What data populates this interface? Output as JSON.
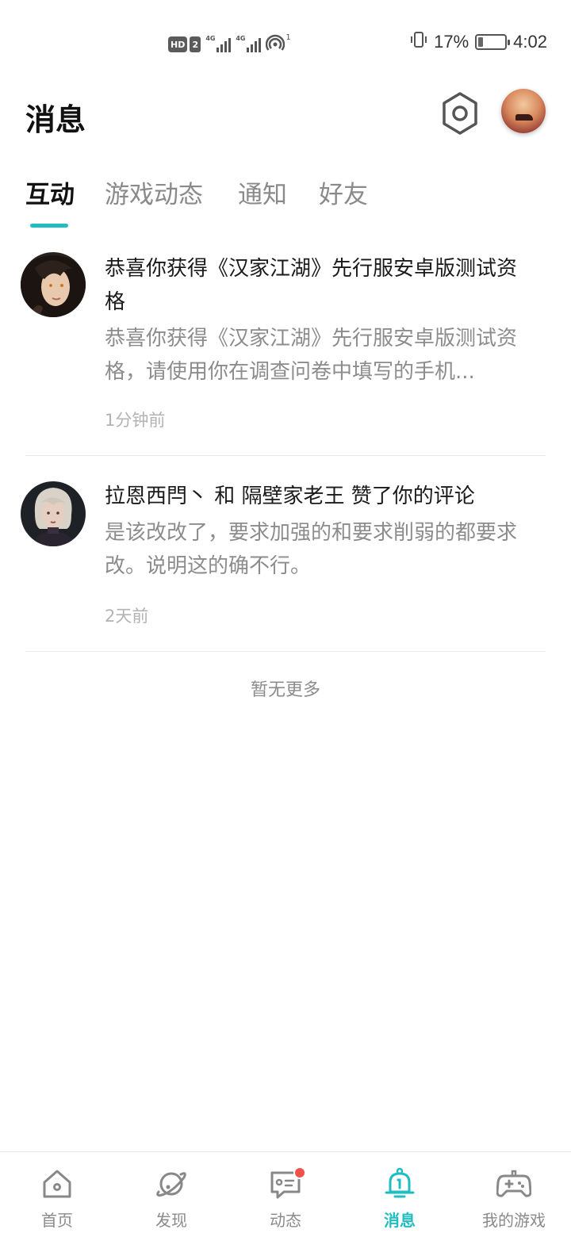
{
  "status_bar": {
    "hd_label": "HD",
    "hd_num": "2",
    "sim1_label": "4G",
    "sim2_label": "4G",
    "hotspot_num": "1",
    "battery_percent": "17%",
    "battery_level": 0.17,
    "time": "4:02"
  },
  "header": {
    "title": "消息"
  },
  "tabs": [
    {
      "label": "互动",
      "active": true
    },
    {
      "label": "游戏动态",
      "active": false
    },
    {
      "label": "通知",
      "active": false
    },
    {
      "label": "好友",
      "active": false
    }
  ],
  "messages": [
    {
      "title": "恭喜你获得《汉家江湖》先行服安卓版测试资格",
      "body": "恭喜你获得《汉家江湖》先行服安卓版测试资格，请使用你在调查问卷中填写的手机...",
      "time": "1分钟前"
    },
    {
      "title": "拉恩西閂丶 和 隔壁家老王 赞了你的评论",
      "body": "是该改改了，要求加强的和要求削弱的都要求改。说明这的确不行。",
      "time": "2天前"
    }
  ],
  "footer_note": "暂无更多",
  "bottom_nav": [
    {
      "label": "首页",
      "icon": "home-icon",
      "active": false
    },
    {
      "label": "发现",
      "icon": "planet-icon",
      "active": false
    },
    {
      "label": "动态",
      "icon": "chat-icon",
      "active": false,
      "badge": true
    },
    {
      "label": "消息",
      "icon": "bell-icon",
      "active": true
    },
    {
      "label": "我的游戏",
      "icon": "gamepad-icon",
      "active": false
    }
  ],
  "colors": {
    "accent": "#1fbdc1",
    "badge": "#f0524b",
    "muted": "#8c8c8c"
  }
}
